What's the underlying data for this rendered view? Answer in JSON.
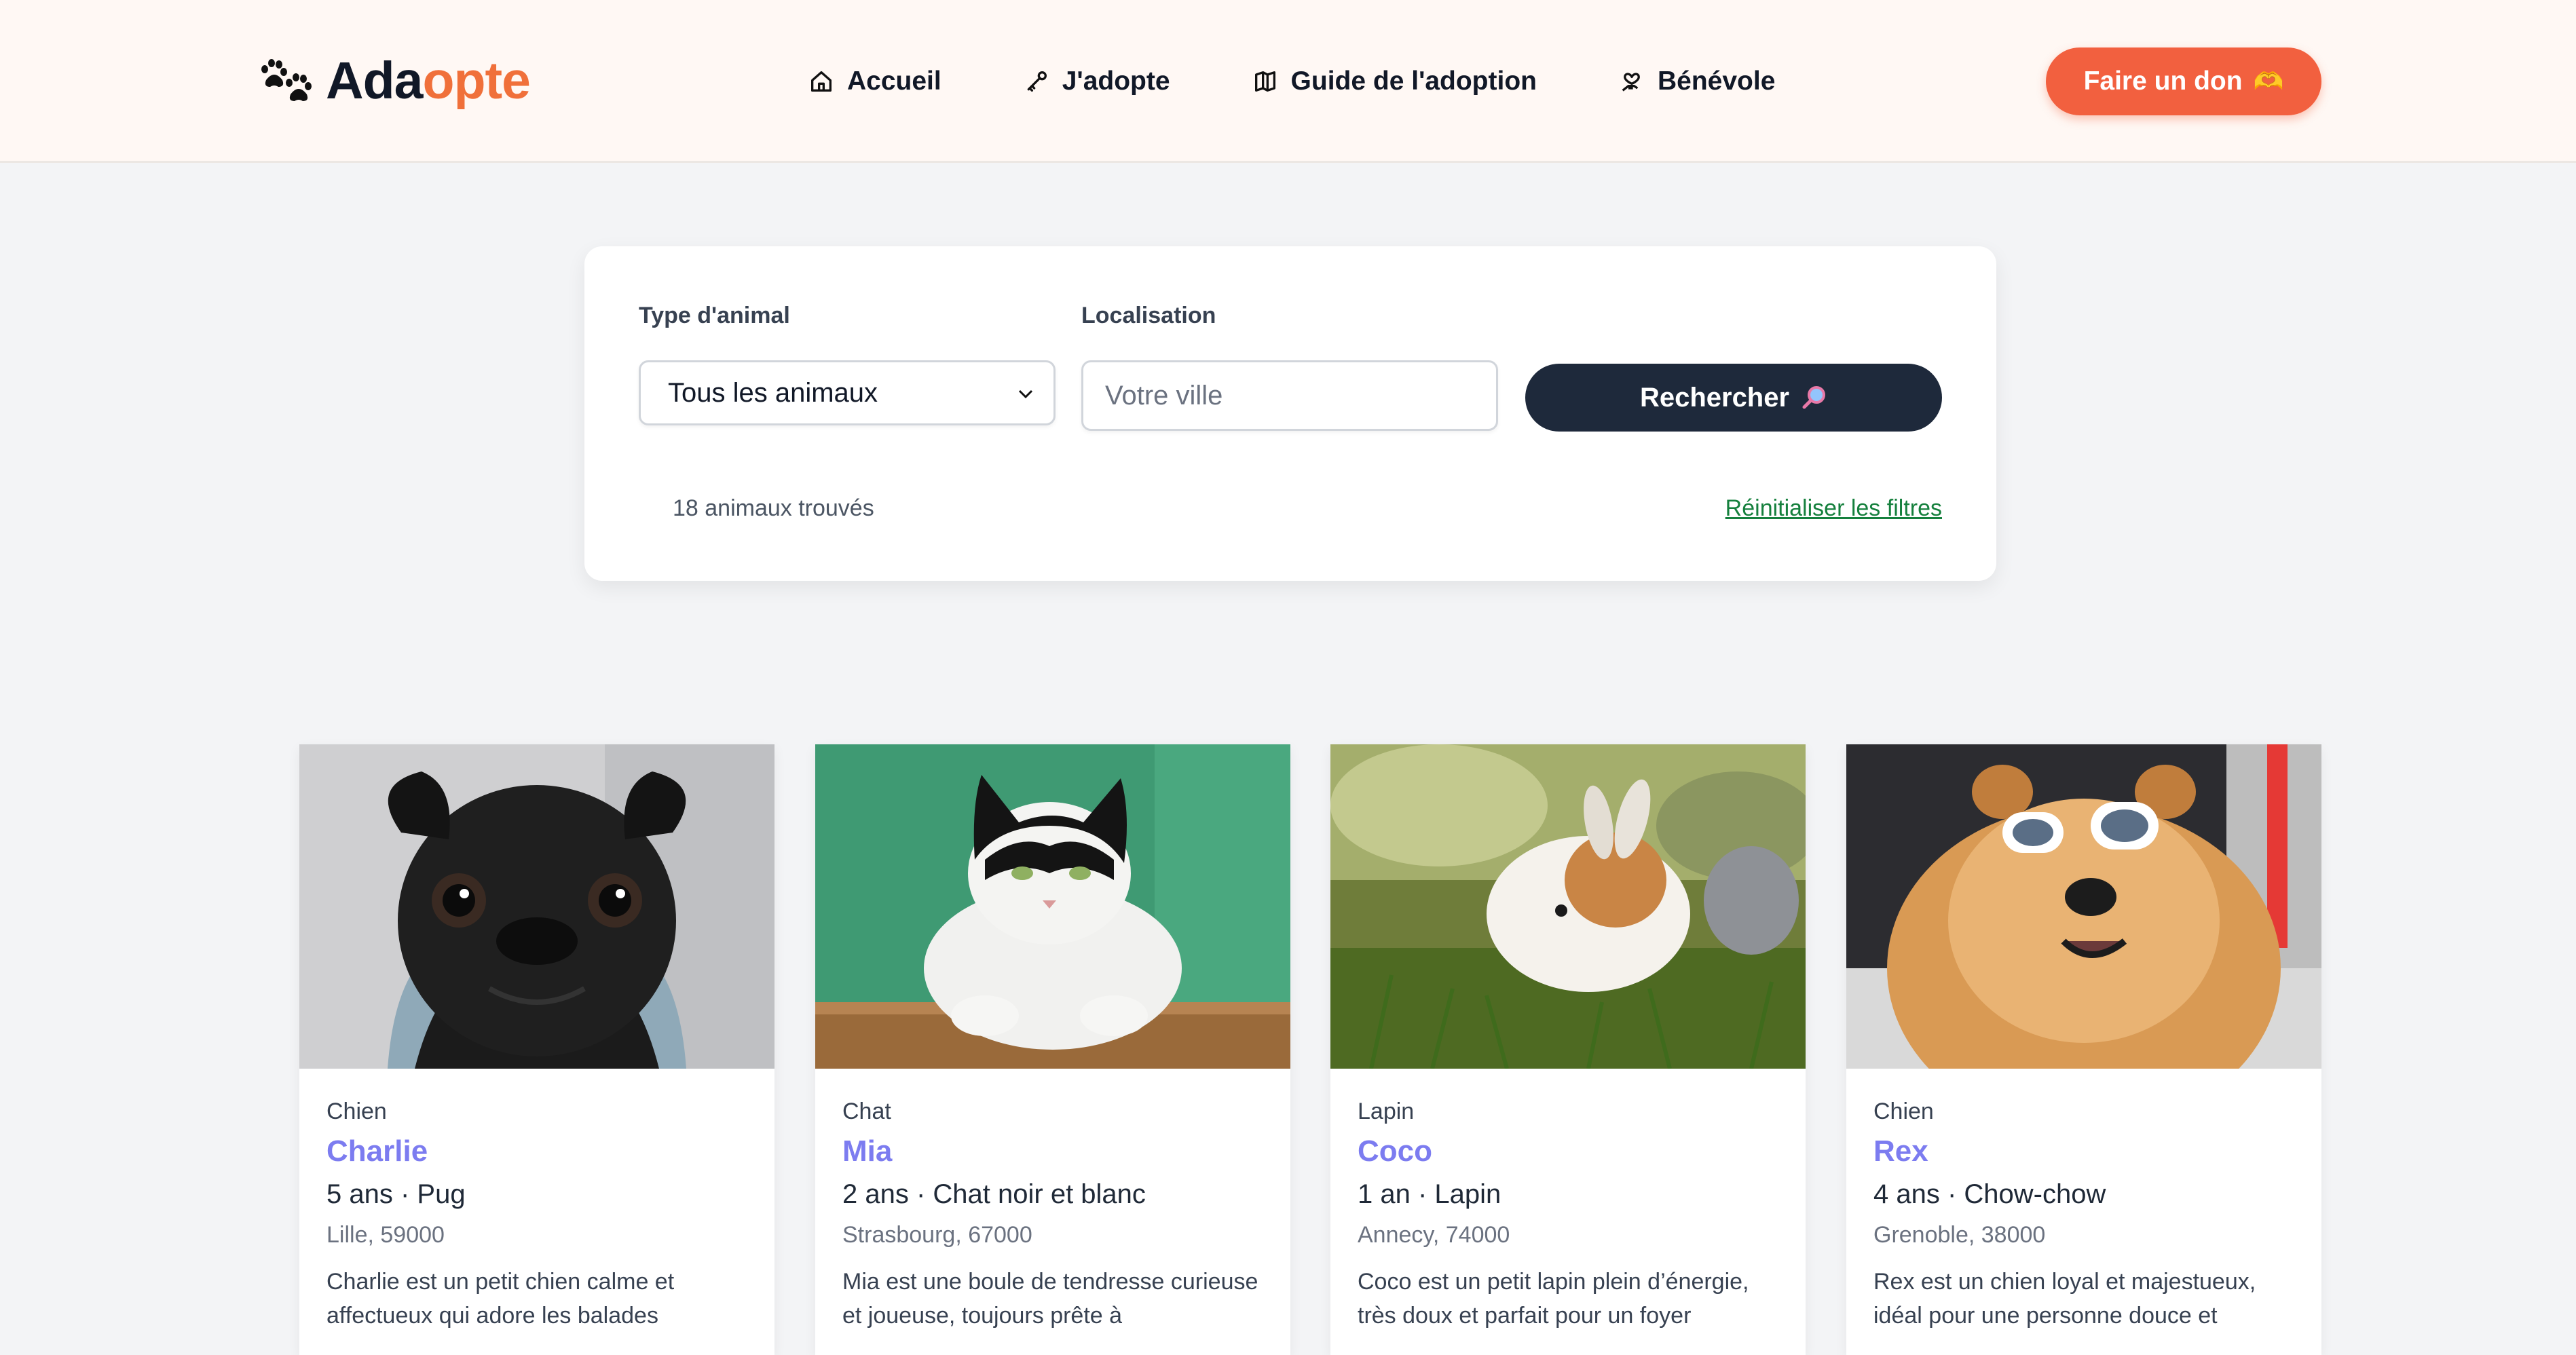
{
  "header": {
    "logo_part1": "Ada",
    "logo_part2": "opte",
    "logo_icon": "paw-prints-icon",
    "nav": [
      {
        "label": "Accueil",
        "icon": "home-icon"
      },
      {
        "label": "J'adopte",
        "icon": "key-icon"
      },
      {
        "label": "Guide de l'adoption",
        "icon": "guide-icon"
      },
      {
        "label": "Bénévole",
        "icon": "volunteer-icon"
      }
    ],
    "donate_label": "Faire un don",
    "donate_icon": "heart-hands-icon"
  },
  "filters": {
    "animal_type_label": "Type d'animal",
    "animal_type_value": "Tous les animaux",
    "location_label": "Localisation",
    "location_placeholder": "Votre ville",
    "location_value": "",
    "search_label": "Rechercher",
    "search_icon": "magnifier-icon",
    "result_count": "18 animaux trouvés",
    "reset_label": "Réinitialiser les filtres"
  },
  "animals": [
    {
      "type": "Chien",
      "name": "Charlie",
      "meta": "5 ans · Pug",
      "location": "Lille, 59000",
      "description": "Charlie est un petit chien calme et affectueux qui adore les balades",
      "photo": "pug-photo"
    },
    {
      "type": "Chat",
      "name": "Mia",
      "meta": "2 ans · Chat noir et blanc",
      "location": "Strasbourg, 67000",
      "description": "Mia est une boule de tendresse curieuse et joueuse, toujours prête à",
      "photo": "cat-photo"
    },
    {
      "type": "Lapin",
      "name": "Coco",
      "meta": "1 an · Lapin",
      "location": "Annecy, 74000",
      "description": "Coco est un petit lapin plein d’énergie, très doux et parfait pour un foyer",
      "photo": "rabbit-photo"
    },
    {
      "type": "Chien",
      "name": "Rex",
      "meta": "4 ans · Chow-chow",
      "location": "Grenoble, 38000",
      "description": "Rex est un chien loyal et majestueux, idéal pour une personne douce et",
      "photo": "chowchow-photo"
    }
  ],
  "colors": {
    "brand_orange": "#f0703a",
    "donate_button": "#f2603f",
    "search_button": "#1e293b",
    "animal_name": "#7c7cf0",
    "reset_link": "#15803d"
  }
}
